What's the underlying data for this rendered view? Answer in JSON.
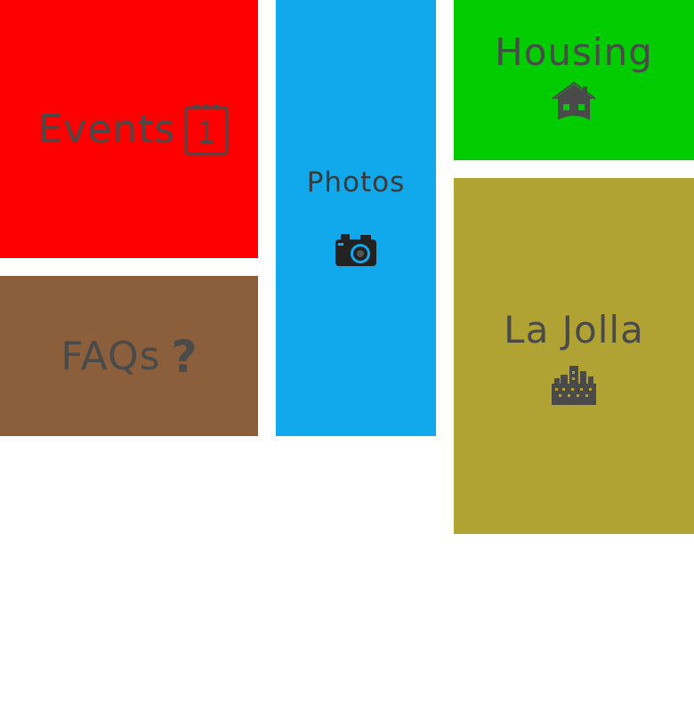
{
  "tiles": {
    "events": {
      "label": "Events",
      "color": "#ff0000",
      "icon": "calendar-icon",
      "calendar_day": "1"
    },
    "faqs": {
      "label": "FAQs",
      "color": "#8b5e3c",
      "icon": "question-icon",
      "icon_glyph": "?"
    },
    "photos": {
      "label": "Photos",
      "color": "#12a9ec",
      "icon": "camera-icon"
    },
    "housing": {
      "label": "Housing",
      "color": "#00cc00",
      "icon": "house-icon"
    },
    "lajolla": {
      "label": "La Jolla",
      "color": "#b0a334",
      "icon": "city-icon"
    }
  },
  "colors": {
    "text": "#4a4a4a",
    "background": "#ffffff"
  }
}
